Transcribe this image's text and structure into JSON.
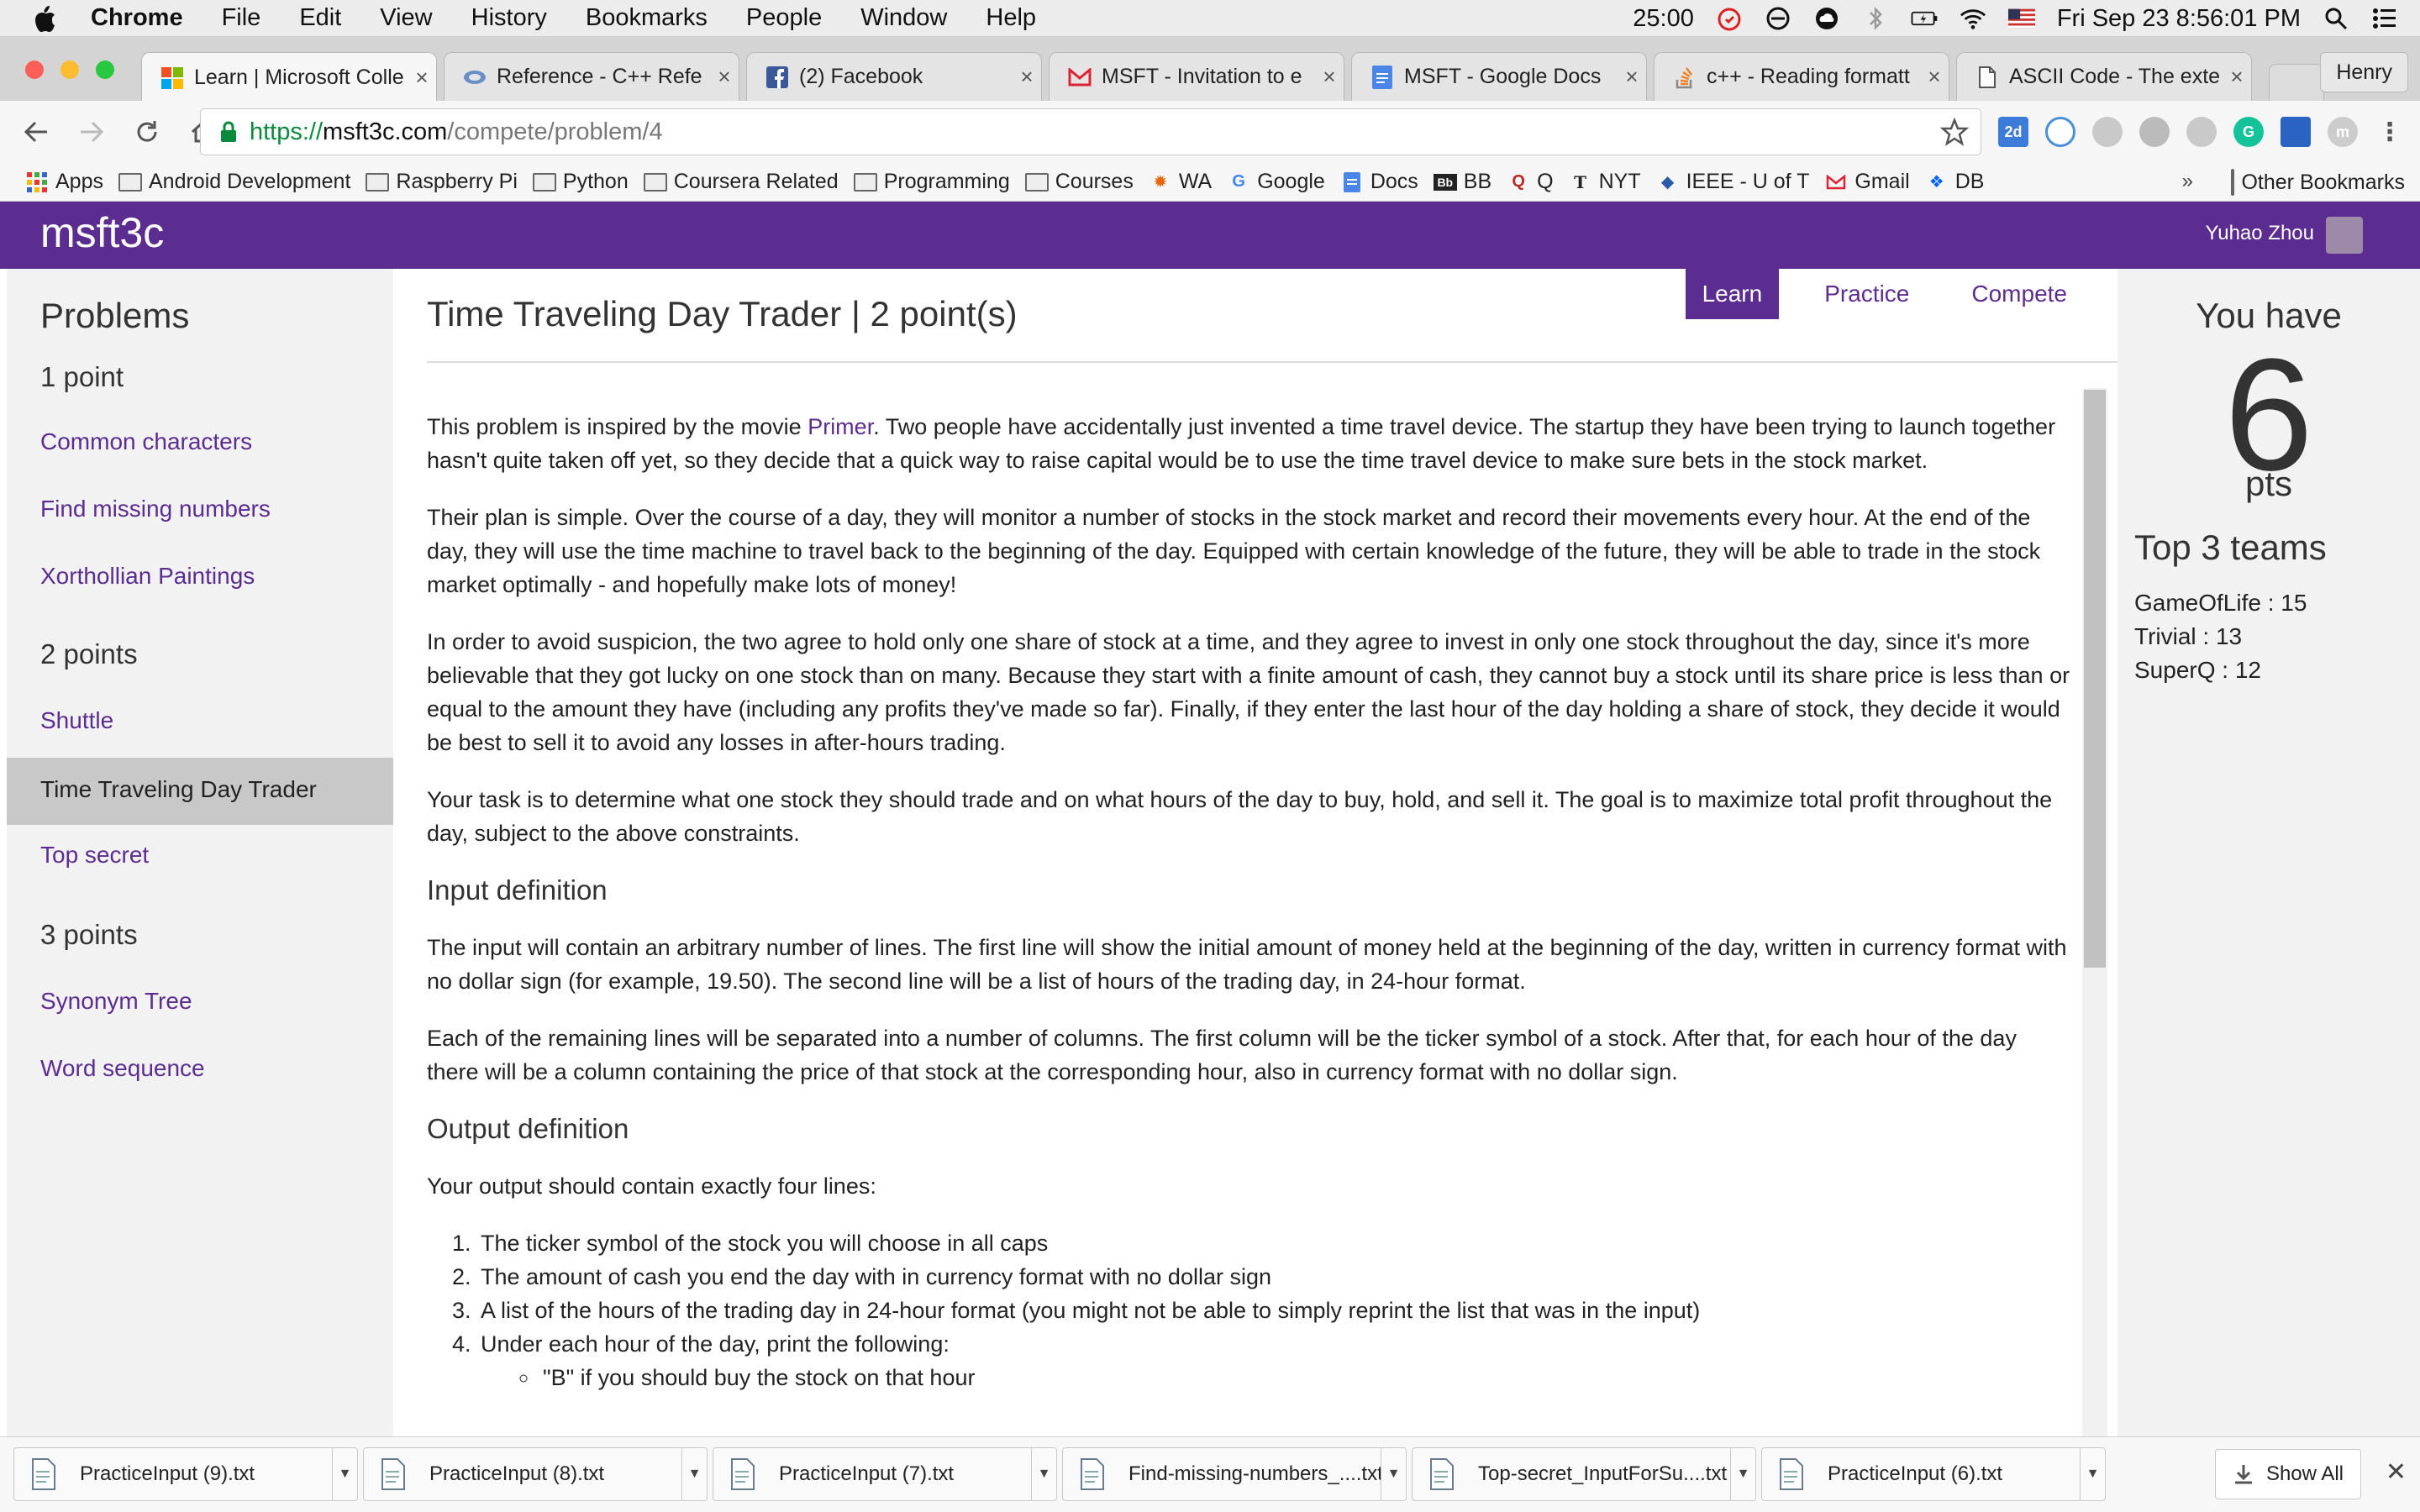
{
  "menubar": {
    "app_name": "Chrome",
    "menus": [
      "File",
      "Edit",
      "View",
      "History",
      "Bookmarks",
      "People",
      "Window",
      "Help"
    ],
    "timer": "25:00",
    "datetime": "Fri Sep 23  8:56:01 PM"
  },
  "tabs": [
    {
      "title": "Learn | Microsoft Colle",
      "icon": "microsoft-icon",
      "active": true
    },
    {
      "title": "Reference - C++ Refe",
      "icon": "cplusplus-icon",
      "active": false
    },
    {
      "title": "(2) Facebook",
      "icon": "facebook-icon",
      "active": false
    },
    {
      "title": "MSFT - Invitation to e",
      "icon": "gmail-icon",
      "active": false
    },
    {
      "title": "MSFT - Google Docs",
      "icon": "google-docs-icon",
      "active": false
    },
    {
      "title": "c++ - Reading formatt",
      "icon": "stackoverflow-icon",
      "active": false
    },
    {
      "title": "ASCII Code - The exte",
      "icon": "page-icon",
      "active": false
    }
  ],
  "profile_name": "Henry",
  "address": {
    "scheme": "https://",
    "host": "msft3c.com",
    "path": "/compete/problem/4"
  },
  "bookmarks": [
    {
      "label": "Apps",
      "icon": "apps-grid-icon"
    },
    {
      "label": "Android Development",
      "icon": "folder-icon"
    },
    {
      "label": "Raspberry Pi",
      "icon": "folder-icon"
    },
    {
      "label": "Python",
      "icon": "folder-icon"
    },
    {
      "label": "Coursera Related",
      "icon": "folder-icon"
    },
    {
      "label": "Programming",
      "icon": "folder-icon"
    },
    {
      "label": "Courses",
      "icon": "folder-icon"
    },
    {
      "label": "WA",
      "icon": "wolfram-icon"
    },
    {
      "label": "Google",
      "icon": "google-icon"
    },
    {
      "label": "Docs",
      "icon": "docs-icon"
    },
    {
      "label": "BB",
      "icon": "bb-icon"
    },
    {
      "label": "Q",
      "icon": "quora-icon"
    },
    {
      "label": "NYT",
      "icon": "nyt-icon"
    },
    {
      "label": "IEEE - U of T",
      "icon": "ieee-icon"
    },
    {
      "label": "Gmail",
      "icon": "gmail-icon"
    },
    {
      "label": "DB",
      "icon": "dropbox-icon"
    }
  ],
  "bookmarks_other": "Other Bookmarks",
  "site": {
    "logo": "msft3c",
    "user_name": "Yuhao Zhou"
  },
  "sidebar": {
    "title": "Problems",
    "sections": [
      {
        "heading": "1 point",
        "items": [
          "Common characters",
          "Find missing numbers",
          "Xorthollian Paintings"
        ]
      },
      {
        "heading": "2 points",
        "items": [
          "Shuttle",
          "Time Traveling Day Trader",
          "Top secret"
        ]
      },
      {
        "heading": "3 points",
        "items": [
          "Synonym Tree",
          "Word sequence"
        ]
      }
    ],
    "active_item": "Time Traveling Day Trader"
  },
  "main": {
    "title": "Time Traveling Day Trader | 2 point(s)",
    "tabs": [
      "Learn",
      "Practice",
      "Compete"
    ],
    "active_tab": "Learn",
    "p1_before": "This problem is inspired by the movie ",
    "p1_link": "Primer",
    "p1_after": ". Two people have accidentally just invented a time travel device. The startup they have been trying to launch together hasn't quite taken off yet, so they decide that a quick way to raise capital would be to use the time travel device to make sure bets in the stock market.",
    "p2": "Their plan is simple. Over the course of a day, they will monitor a number of stocks in the stock market and record their movements every hour. At the end of the day, they will use the time machine to travel back to the beginning of the day. Equipped with certain knowledge of the future, they will be able to trade in the stock market optimally - and hopefully make lots of money!",
    "p3": "In order to avoid suspicion, the two agree to hold only one share of stock at a time, and they agree to invest in only one stock throughout the day, since it's more believable that they got lucky on one stock than on many. Because they start with a finite amount of cash, they cannot buy a stock until its share price is less than or equal to the amount they have (including any profits they've made so far). Finally, if they enter the last hour of the day holding a share of stock, they decide it would be best to sell it to avoid any losses in after-hours trading.",
    "p4": "Your task is to determine what one stock they should trade and on what hours of the day to buy, hold, and sell it. The goal is to maximize total profit throughout the day, subject to the above constraints.",
    "h_input": "Input definition",
    "p5": "The input will contain an arbitrary number of lines. The first line will show the initial amount of money held at the beginning of the day, written in currency format with no dollar sign (for example, 19.50). The second line will be a list of hours of the trading day, in 24-hour format.",
    "p6": "Each of the remaining lines will be separated into a number of columns. The first column will be the ticker symbol of a stock. After that, for each hour of the day there will be a column containing the price of that stock at the corresponding hour, also in currency format with no dollar sign.",
    "h_output": "Output definition",
    "p7": "Your output should contain exactly four lines:",
    "output_list": [
      "The ticker symbol of the stock you will choose in all caps",
      "The amount of cash you end the day with in currency format with no dollar sign",
      "A list of the hours of the trading day in 24-hour format (you might not be able to simply reprint the list that was in the input)",
      "Under each hour of the day, print the following:"
    ],
    "sub_item": "\"B\" if you should buy the stock on that hour"
  },
  "right_panel": {
    "you_have": "You have",
    "points": "6",
    "pts": "pts",
    "top_title": "Top 3 teams",
    "teams": [
      "GameOfLife : 15",
      "Trivial : 13",
      "SuperQ : 12"
    ]
  },
  "downloads": {
    "items": [
      "PracticeInput (9).txt",
      "PracticeInput (8).txt",
      "PracticeInput (7).txt",
      "Find-missing-numbers_....txt",
      "Top-secret_InputForSu....txt",
      "PracticeInput (6).txt"
    ],
    "show_all": "Show All"
  },
  "colors": {
    "brand": "#5c2d91",
    "sidebar_bg": "#f2f2f2",
    "active_item_bg": "#c8c8c8"
  }
}
